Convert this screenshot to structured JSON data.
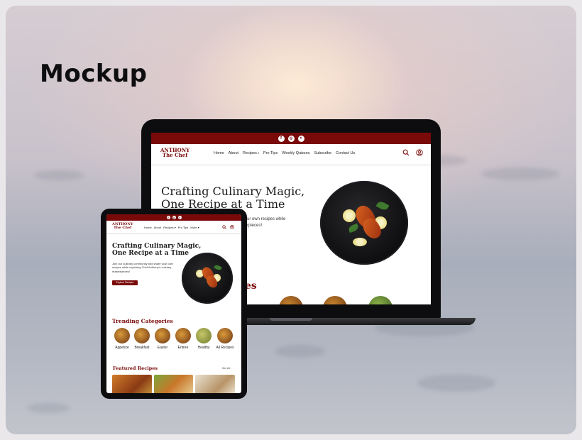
{
  "mockup_title": "Mockup",
  "colors": {
    "brand": "#7a0a0a",
    "background": "#c9c2cb"
  },
  "site": {
    "brand_line1": "ANTHONY",
    "brand_line2": "The Chef",
    "social_icons": [
      "facebook-icon",
      "instagram-icon",
      "twitter-icon"
    ],
    "nav_laptop": [
      "Home",
      "About",
      "Recipes",
      "Pro Tips",
      "Weekly Quizzes",
      "Subscribe",
      "Contact Us"
    ],
    "nav_tablet": [
      "Home",
      "About",
      "Recipes",
      "Pro Tips",
      "More"
    ],
    "hero_line1": "Crafting Culinary Magic,",
    "hero_line2": "One Recipe at a Time",
    "laptop_hero_fragment1": "ur own recipes while",
    "laptop_hero_fragment2": "rpieces!",
    "laptop_section_fragment": "es",
    "hero_text": "Join our culinary community and share your own recipes while exploring Chef Anthony's culinary masterpieces!",
    "cta_label": "Explore Recipes",
    "trending_title": "Trending Categories",
    "categories": [
      "Appetize",
      "Breakfast",
      "Easter",
      "Entree",
      "Healthy",
      "All Recipes"
    ],
    "featured_title": "Featured Recipes",
    "see_all": "See All"
  }
}
